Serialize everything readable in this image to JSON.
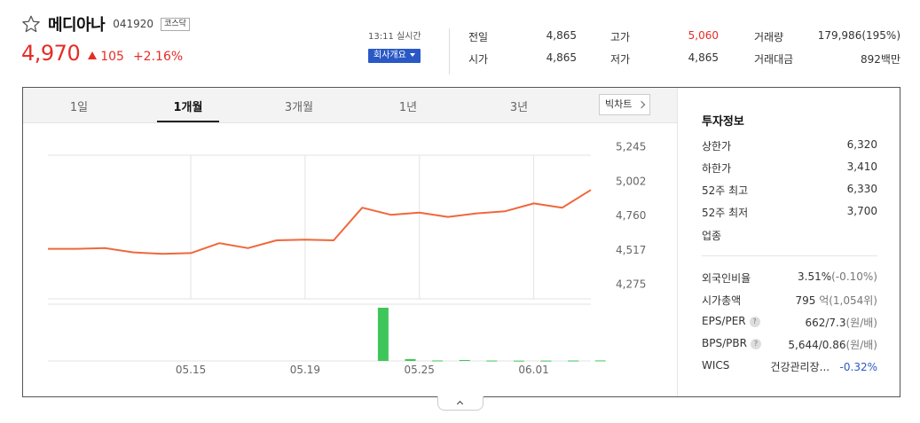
{
  "stock": {
    "name": "메디아나",
    "code": "041920",
    "market": "코스닥",
    "price": "4,970",
    "change": "105",
    "change_pct": "+2.16%",
    "realtime": "13:11 실시간",
    "company_info_label": "회사개요"
  },
  "summary": {
    "prev_close_label": "전일",
    "prev_close": "4,865",
    "open_label": "시가",
    "open": "4,865",
    "high_label": "고가",
    "high": "5,060",
    "low_label": "저가",
    "low": "4,865",
    "volume_label": "거래량",
    "volume": "179,986(195%)",
    "value_label": "거래대금",
    "value": "892백만"
  },
  "tabs": [
    "1일",
    "1개월",
    "3개월",
    "1년",
    "3년"
  ],
  "active_tab": "1개월",
  "big_chart_label": "빅차트",
  "chart_data": {
    "type": "line",
    "x_labels": [
      "05.15",
      "05.19",
      "05.25",
      "06.01"
    ],
    "x_label_index": [
      5,
      9,
      13,
      17
    ],
    "ylim": [
      4160,
      5360
    ],
    "yticks": [
      4275,
      4517,
      4760,
      5002,
      5245
    ],
    "ytick_labels": [
      "4,275",
      "4,517",
      "4,760",
      "5,002",
      "5,245"
    ],
    "grid": true,
    "price": [
      4525,
      4525,
      4530,
      4500,
      4490,
      4495,
      4565,
      4530,
      4585,
      4590,
      4585,
      4815,
      4765,
      4780,
      4750,
      4775,
      4790,
      4845,
      4815,
      4940
    ],
    "volume": [
      0,
      0,
      0,
      0,
      0,
      0,
      0,
      0,
      0,
      0,
      0,
      0,
      175000,
      6000,
      1500,
      3000,
      1200,
      900,
      1100,
      1300,
      1600
    ],
    "line_color": "#f0673b",
    "volume_color": "#3ec65b"
  },
  "info": {
    "title": "투자정보",
    "upper_limit_label": "상한가",
    "upper_limit": "6,320",
    "lower_limit_label": "하한가",
    "lower_limit": "3,410",
    "high52_label": "52주 최고",
    "high52": "6,330",
    "low52_label": "52주 최저",
    "low52": "3,700",
    "sector_label": "업종",
    "foreign_label": "외국인비율",
    "foreign": "3.51%",
    "foreign_chg": "(-0.10%)",
    "mcap_label": "시가총액",
    "mcap": "795",
    "mcap_unit": "억",
    "mcap_extra": "(1,054위)",
    "eps_label": "EPS/PER",
    "eps": "662/7.3",
    "eps_unit": "(원/배)",
    "bps_label": "BPS/PBR",
    "bps": "5,644/0.86",
    "bps_unit": "(원/배)",
    "wics_label": "WICS",
    "wics": "건강관리장...",
    "wics_chg": "-0.32%",
    "help_mark": "?"
  },
  "colors": {
    "up": "#e52d27",
    "down": "#2a59c6",
    "accent": "#2a59c6"
  }
}
